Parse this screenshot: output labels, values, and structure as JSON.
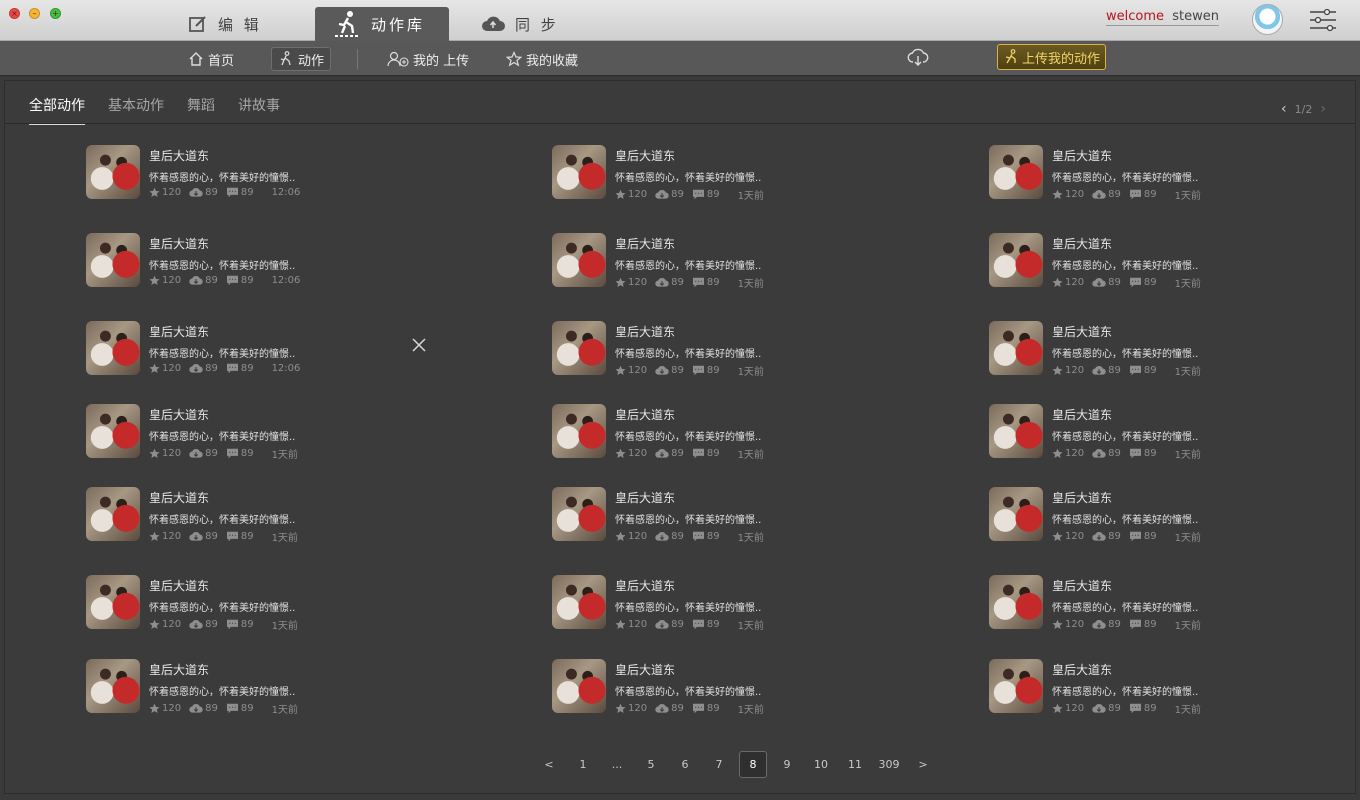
{
  "main_tabs": {
    "edit": "编 辑",
    "library": "动作库",
    "sync": "同 步"
  },
  "user": {
    "welcome": "welcome",
    "name": "stewen"
  },
  "subnav": {
    "home": "首页",
    "action": "动作",
    "my_upload": "我的 上传",
    "my_fav": "我的收藏",
    "upload_mine": "上传我的动作"
  },
  "categories": [
    "全部动作",
    "基本动作",
    "舞蹈",
    "讲故事"
  ],
  "pager_top": "1/2",
  "cards": [
    {
      "title": "皇后大道东",
      "desc": "怀着感恩的心，怀着美好的憧憬..",
      "likes": "120",
      "downloads": "89",
      "comments": "89",
      "time": "12:06"
    },
    {
      "title": "皇后大道东",
      "desc": "怀着感恩的心，怀着美好的憧憬..",
      "likes": "120",
      "downloads": "89",
      "comments": "89",
      "time": "1天前"
    },
    {
      "title": "皇后大道东",
      "desc": "怀着感恩的心，怀着美好的憧憬..",
      "likes": "120",
      "downloads": "89",
      "comments": "89",
      "time": "1天前"
    },
    {
      "title": "皇后大道东",
      "desc": "怀着感恩的心，怀着美好的憧憬..",
      "likes": "120",
      "downloads": "89",
      "comments": "89",
      "time": "12:06"
    },
    {
      "title": "皇后大道东",
      "desc": "怀着感恩的心，怀着美好的憧憬..",
      "likes": "120",
      "downloads": "89",
      "comments": "89",
      "time": "1天前"
    },
    {
      "title": "皇后大道东",
      "desc": "怀着感恩的心，怀着美好的憧憬..",
      "likes": "120",
      "downloads": "89",
      "comments": "89",
      "time": "1天前"
    },
    {
      "title": "皇后大道东",
      "desc": "怀着感恩的心，怀着美好的憧憬..",
      "likes": "120",
      "downloads": "89",
      "comments": "89",
      "time": "12:06"
    },
    {
      "title": "皇后大道东",
      "desc": "怀着感恩的心，怀着美好的憧憬..",
      "likes": "120",
      "downloads": "89",
      "comments": "89",
      "time": "1天前"
    },
    {
      "title": "皇后大道东",
      "desc": "怀着感恩的心，怀着美好的憧憬..",
      "likes": "120",
      "downloads": "89",
      "comments": "89",
      "time": "1天前"
    },
    {
      "title": "皇后大道东",
      "desc": "怀着感恩的心，怀着美好的憧憬..",
      "likes": "120",
      "downloads": "89",
      "comments": "89",
      "time": "1天前"
    },
    {
      "title": "皇后大道东",
      "desc": "怀着感恩的心，怀着美好的憧憬..",
      "likes": "120",
      "downloads": "89",
      "comments": "89",
      "time": "1天前"
    },
    {
      "title": "皇后大道东",
      "desc": "怀着感恩的心，怀着美好的憧憬..",
      "likes": "120",
      "downloads": "89",
      "comments": "89",
      "time": "1天前"
    },
    {
      "title": "皇后大道东",
      "desc": "怀着感恩的心，怀着美好的憧憬..",
      "likes": "120",
      "downloads": "89",
      "comments": "89",
      "time": "1天前"
    },
    {
      "title": "皇后大道东",
      "desc": "怀着感恩的心，怀着美好的憧憬..",
      "likes": "120",
      "downloads": "89",
      "comments": "89",
      "time": "1天前"
    },
    {
      "title": "皇后大道东",
      "desc": "怀着感恩的心，怀着美好的憧憬..",
      "likes": "120",
      "downloads": "89",
      "comments": "89",
      "time": "1天前"
    },
    {
      "title": "皇后大道东",
      "desc": "怀着感恩的心，怀着美好的憧憬..",
      "likes": "120",
      "downloads": "89",
      "comments": "89",
      "time": "1天前"
    },
    {
      "title": "皇后大道东",
      "desc": "怀着感恩的心，怀着美好的憧憬..",
      "likes": "120",
      "downloads": "89",
      "comments": "89",
      "time": "1天前"
    },
    {
      "title": "皇后大道东",
      "desc": "怀着感恩的心，怀着美好的憧憬..",
      "likes": "120",
      "downloads": "89",
      "comments": "89",
      "time": "1天前"
    },
    {
      "title": "皇后大道东",
      "desc": "怀着感恩的心，怀着美好的憧憬..",
      "likes": "120",
      "downloads": "89",
      "comments": "89",
      "time": "1天前"
    },
    {
      "title": "皇后大道东",
      "desc": "怀着感恩的心，怀着美好的憧憬..",
      "likes": "120",
      "downloads": "89",
      "comments": "89",
      "time": "1天前"
    },
    {
      "title": "皇后大道东",
      "desc": "怀着感恩的心，怀着美好的憧憬..",
      "likes": "120",
      "downloads": "89",
      "comments": "89",
      "time": "1天前"
    }
  ],
  "pagination": [
    "<",
    "1",
    "...",
    "5",
    "6",
    "7",
    "8",
    "9",
    "10",
    "11",
    "309",
    ">"
  ],
  "pagination_active": "8",
  "colors": {
    "accent_gold": "#d7b347",
    "welcome_red": "#b3161c",
    "bg": "#3a3a3a"
  }
}
